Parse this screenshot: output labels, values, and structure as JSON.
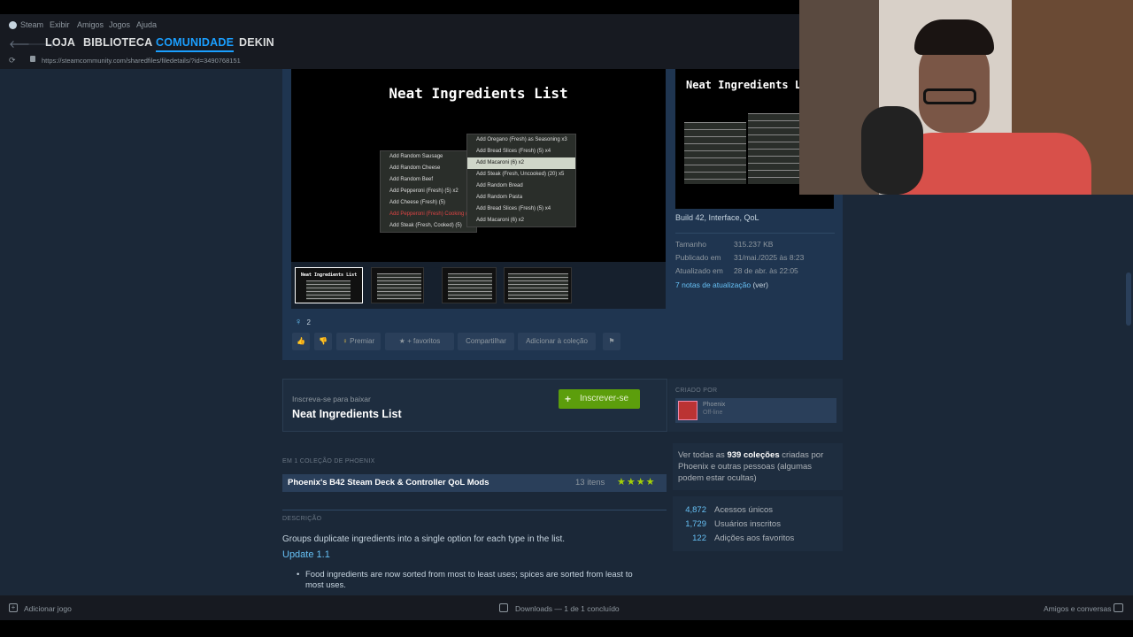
{
  "menubar": {
    "steam": "Steam",
    "exibir": "Exibir",
    "amigos": "Amigos",
    "jogos": "Jogos",
    "ajuda": "Ajuda"
  },
  "nav": {
    "loja": "LOJA",
    "biblioteca": "BIBLIOTECA",
    "comunidade": "COMUNIDADE",
    "user": "DEKIN"
  },
  "url": "https://steamcommunity.com/sharedfiles/filedetails/?id=3490768151",
  "preview": {
    "title": "Neat Ingredients List",
    "left_menu": [
      "Add Random Sausage",
      "Add Random Cheese",
      "Add Random Beef",
      "Add Pepperoni (Fresh) (5) x2",
      "Add Cheese (Fresh) (5)",
      "Add Pepperoni (Fresh) Cooking (4)",
      "Add Steak (Fresh, Cooked) (5)"
    ],
    "right_menu": [
      "Add Oregano (Fresh) as Seasoning x3",
      "Add Bread Slices (Fresh) (5) x4",
      "Add Macaroni (6) x2",
      "Add Steak (Fresh, Uncooked) (20) x5",
      "Add Random Bread",
      "Add Random Pasta",
      "Add Bread Slices (Fresh) (5) x4",
      "Add Macaroni (6) x2"
    ],
    "side_title": "Neat Ingredients L"
  },
  "details": {
    "tags": "Build 42, Interface, QoL",
    "size_label": "Tamanho",
    "size": "315.237 KB",
    "published_label": "Publicado em",
    "published": "31/mai./2025 às 8:23",
    "updated_label": "Atualizado em",
    "updated": "28 de abr. às 22:05",
    "notes": "7 notas de atualização",
    "notes_view": "(ver)"
  },
  "awards_count": "2",
  "actions": {
    "premiar": "Premiar",
    "favoritos": "+ favoritos",
    "compartilhar": "Compartilhar",
    "colecao": "Adicionar à coleção"
  },
  "subscribe": {
    "hint": "Inscreva-se para baixar",
    "title": "Neat Ingredients List",
    "button": "Inscrever-se"
  },
  "creator": {
    "label": "CRIADO POR",
    "name": "Phoenix",
    "status": "Off-line"
  },
  "collection": {
    "label": "EM 1 COLEÇÃO DE PHOENIX",
    "name": "Phoenix's B42 Steam Deck & Controller QoL Mods",
    "count": "13 itens",
    "stars": "★★★★"
  },
  "collections_text": {
    "pre": "Ver todas as",
    "count": "939 coleções",
    "post": "criadas por Phoenix e outras pessoas (algumas podem estar ocultas)"
  },
  "stats": [
    {
      "num": "4,872",
      "label": "Acessos únicos"
    },
    {
      "num": "1,729",
      "label": "Usuários inscritos"
    },
    {
      "num": "122",
      "label": "Adições aos favoritos"
    }
  ],
  "description": {
    "label": "DESCRIÇÃO",
    "text": "Groups duplicate ingredients into a single option for each type in the list.",
    "update": "Update 1.1",
    "bullet": "Food ingredients are now sorted from most to least uses; spices are sorted from least to most uses."
  },
  "bottom": {
    "add_game": "Adicionar jogo",
    "downloads": "Downloads — 1 de 1 concluído",
    "friends": "Amigos e conversas"
  }
}
